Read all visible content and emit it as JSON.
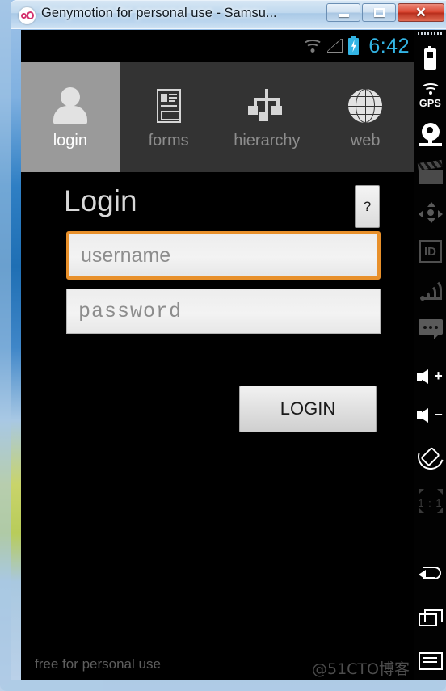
{
  "window": {
    "title": "Genymotion for personal use - Samsu...",
    "app_icon": "genymotion-logo-icon",
    "controls": {
      "minimize": "minimize-icon",
      "maximize": "maximize-icon",
      "close": "✕"
    }
  },
  "statusbar": {
    "time": "6:42",
    "icons": [
      "wifi-icon",
      "cell-signal-icon",
      "battery-charging-icon"
    ]
  },
  "tabs": [
    {
      "label": "login",
      "icon": "person-icon",
      "active": true
    },
    {
      "label": "forms",
      "icon": "forms-icon",
      "active": false
    },
    {
      "label": "hierarchy",
      "icon": "hierarchy-icon",
      "active": false
    },
    {
      "label": "web",
      "icon": "globe-icon",
      "active": false
    }
  ],
  "main": {
    "title": "Login",
    "help_label": "?",
    "username_placeholder": "username",
    "password_placeholder": "password",
    "login_button": "LOGIN",
    "free_label": "free for personal use",
    "watermark": "@51CTO博客"
  },
  "toolbar": [
    {
      "name": "battery-widget",
      "label": ""
    },
    {
      "name": "gps-widget",
      "label": "GPS"
    },
    {
      "name": "camera-widget",
      "label": ""
    },
    {
      "name": "screencast-widget",
      "label": ""
    },
    {
      "name": "dpad-widget",
      "label": ""
    },
    {
      "name": "identifiers-widget",
      "label": "ID"
    },
    {
      "name": "network-widget",
      "label": ""
    },
    {
      "name": "sms-widget",
      "label": ""
    },
    {
      "name": "volume-up-button",
      "label": "+"
    },
    {
      "name": "volume-down-button",
      "label": "−"
    },
    {
      "name": "rotate-button",
      "label": ""
    },
    {
      "name": "scale-one-to-one-button",
      "label": "1 : 1"
    },
    {
      "name": "back-button",
      "label": ""
    },
    {
      "name": "recents-button",
      "label": ""
    },
    {
      "name": "menu-button",
      "label": ""
    }
  ],
  "colors": {
    "accent_orange": "#e8902b",
    "android_blue": "#33b5e5",
    "tab_active_bg": "#9a9a9a",
    "tab_bar_bg": "#333333",
    "close_red": "#d9442f"
  }
}
